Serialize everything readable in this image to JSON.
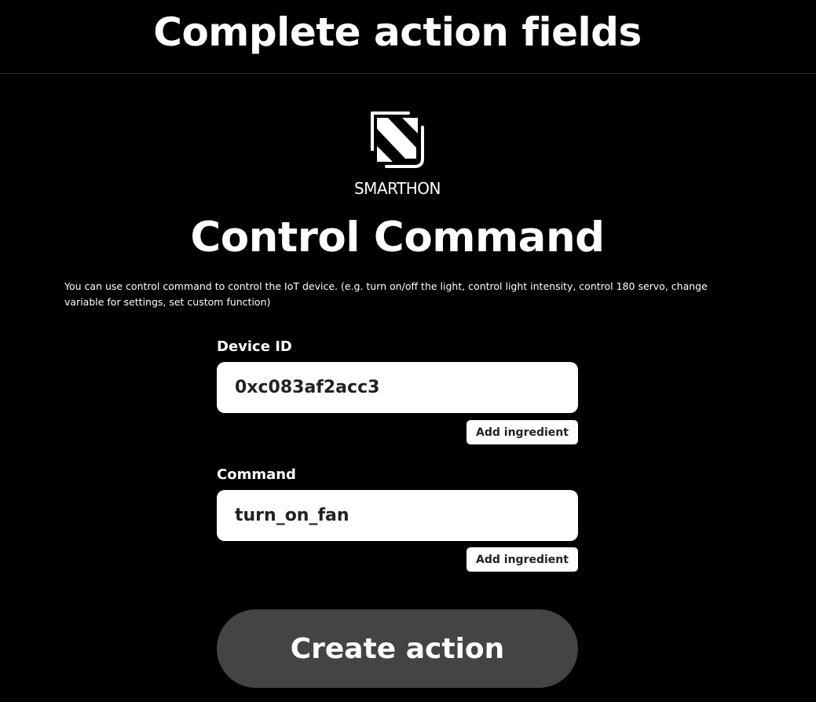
{
  "header": {
    "title": "Complete action fields"
  },
  "service": {
    "logo_text": "SMARTHON",
    "logo_icon": "smarthon-logo-icon",
    "title": "Control Command",
    "description": "You can use control command to control the IoT device. (e.g. turn on/off the light, control light intensity, control 180 servo, change variable for settings, set custom function)"
  },
  "fields": {
    "device_id": {
      "label": "Device ID",
      "value": "0xc083af2acc3",
      "ingredient_label": "Add ingredient"
    },
    "command": {
      "label": "Command",
      "value": "turn_on_fan",
      "ingredient_label": "Add ingredient"
    }
  },
  "actions": {
    "create_label": "Create action"
  },
  "colors": {
    "background": "#000000",
    "text": "#ffffff",
    "input_background": "#ffffff",
    "button_background": "#444444"
  }
}
